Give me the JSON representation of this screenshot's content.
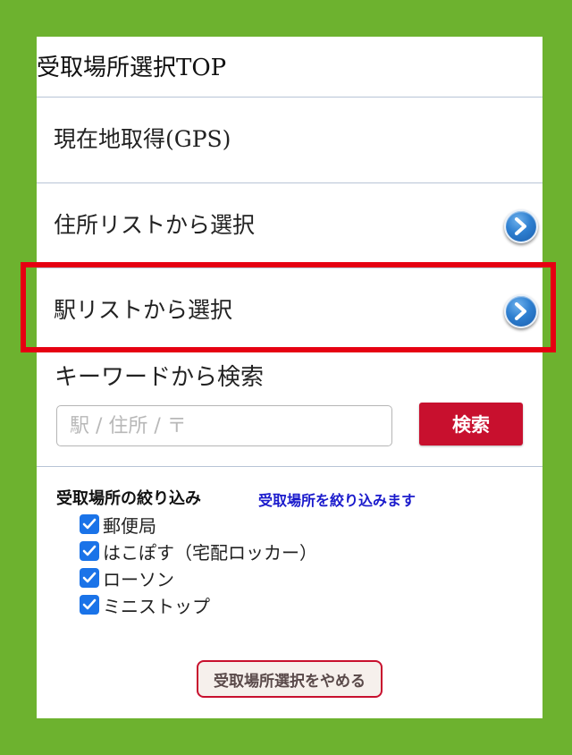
{
  "page_title": "受取場所選択TOP",
  "menu": [
    {
      "label": "現在地取得(GPS)",
      "has_chevron": false
    },
    {
      "label": "住所リストから選択",
      "has_chevron": true
    },
    {
      "label": "駅リストから選択",
      "has_chevron": true
    }
  ],
  "keyword_search": {
    "heading": "キーワードから検索",
    "placeholder": "駅 / 住所 / 〒",
    "value": "",
    "button_label": "検索"
  },
  "filter": {
    "heading": "受取場所の絞り込み",
    "note": "受取場所を絞り込みます",
    "options": [
      {
        "label": "郵便局",
        "checked": true
      },
      {
        "label": "はこぽす（宅配ロッカー）",
        "checked": true
      },
      {
        "label": "ローソン",
        "checked": true
      },
      {
        "label": "ミニストップ",
        "checked": true
      }
    ]
  },
  "cancel_button_label": "受取場所選択をやめる",
  "icons": {
    "chevron": "chevron-right-icon",
    "check": "checkmark-icon"
  },
  "colors": {
    "background": "#6db22f",
    "highlight": "#e60012",
    "search_button": "#c8102e",
    "checkbox": "#1a73e8",
    "filter_note": "#1a1acc"
  }
}
